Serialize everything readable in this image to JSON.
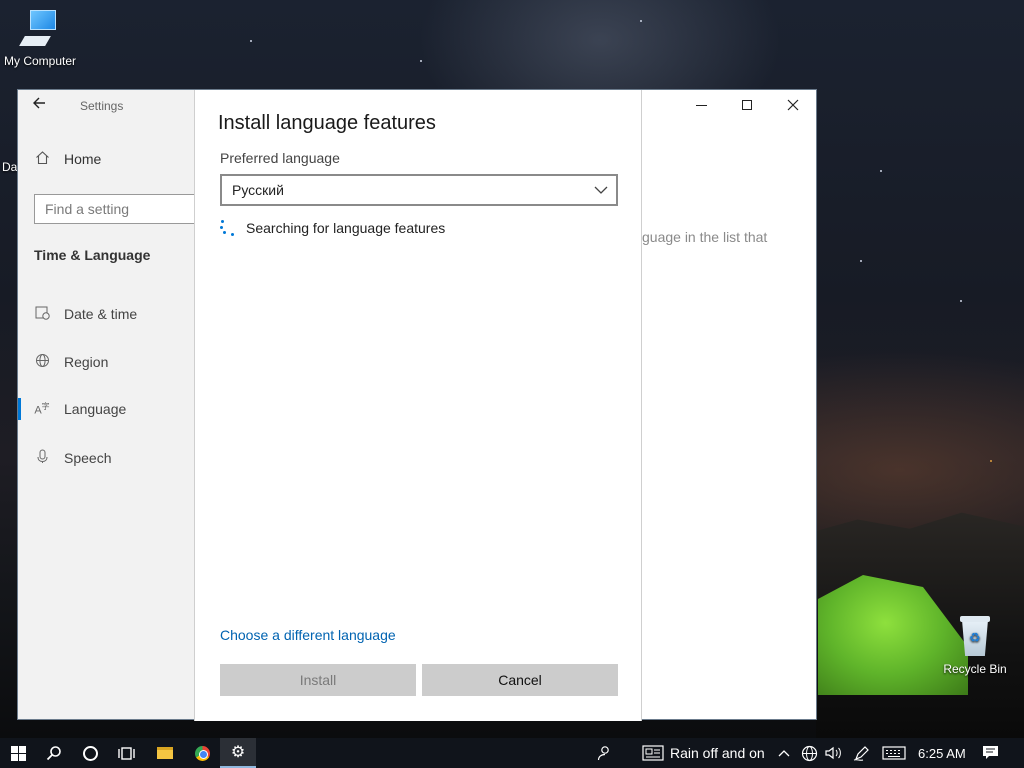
{
  "desktop": {
    "icons": [
      {
        "label": "My Computer",
        "icon": "computer-icon"
      },
      {
        "label": "Recycle Bin",
        "icon": "recycle-bin-icon"
      }
    ],
    "partial_icon_label": "Da"
  },
  "settings_window": {
    "title": "Settings",
    "home_label": "Home",
    "search": {
      "placeholder": "Find a setting",
      "value": ""
    },
    "section_heading": "Time & Language",
    "nav_items": [
      {
        "label": "Date & time",
        "icon": "calendar-clock-icon"
      },
      {
        "label": "Region",
        "icon": "globe-icon"
      },
      {
        "label": "Language",
        "icon": "language-icon",
        "active": true
      },
      {
        "label": "Speech",
        "icon": "microphone-icon"
      }
    ],
    "background_text": "guage in the list that",
    "accent_color": "#0078d7"
  },
  "dialog": {
    "title": "Install language features",
    "preferred_label": "Preferred language",
    "selected_language": "Русский",
    "status_text": "Searching for language features",
    "link_text": "Choose a different language",
    "install_label": "Install",
    "cancel_label": "Cancel",
    "link_color": "#0063b1"
  },
  "taskbar": {
    "weather_text": "Rain off and on",
    "time": "6:25 AM",
    "pinned": [
      "start-icon",
      "search-icon",
      "cortana-icon",
      "task-view-icon",
      "file-explorer-icon",
      "chrome-icon",
      "settings-icon"
    ],
    "tray": [
      "people-icon",
      "news-icon",
      "chevron-up-icon",
      "network-icon",
      "volume-icon",
      "pen-icon",
      "keyboard-icon",
      "notification-icon"
    ]
  }
}
